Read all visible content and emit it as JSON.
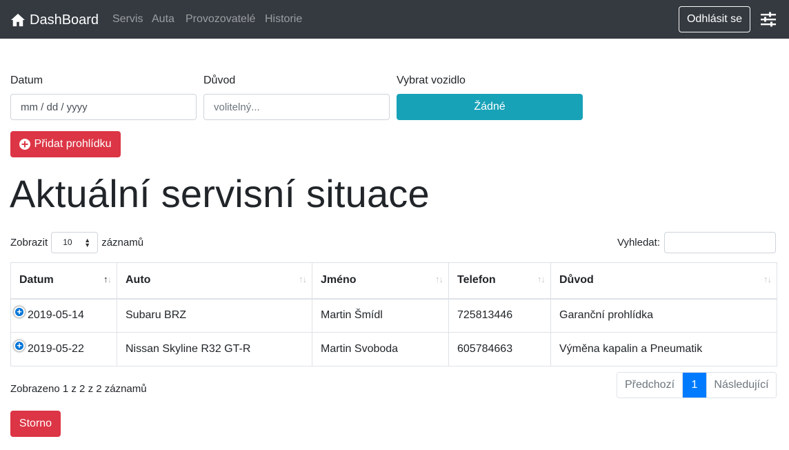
{
  "navbar": {
    "brand": "DashBoard",
    "links": [
      "Servis",
      "Auta",
      "Provozovatelé",
      "Historie"
    ],
    "logout_label": "Odhlásit se"
  },
  "form": {
    "date_label": "Datum",
    "date_placeholder": "mm / dd / yyyy",
    "reason_label": "Důvod",
    "reason_placeholder": "volitelný...",
    "vehicle_label": "Vybrat vozidlo",
    "vehicle_value": "Žádné",
    "add_button": "Přidat prohlídku"
  },
  "page_title": "Aktuální servisní situace",
  "datatable": {
    "length_prefix": "Zobrazit",
    "length_value": "10",
    "length_suffix": "záznamů",
    "search_label": "Vyhledat:",
    "columns": [
      "Datum",
      "Auto",
      "Jméno",
      "Telefon",
      "Důvod"
    ],
    "rows": [
      [
        "2019-05-14",
        "Subaru BRZ",
        "Martin Šmídl",
        "725813446",
        "Garanční prohlídka"
      ],
      [
        "2019-05-22",
        "Nissan Skyline R32 GT-R",
        "Martin Svoboda",
        "605784663",
        "Výměna kapalin a Pneumatik"
      ]
    ],
    "info": "Zobrazeno 1 z 2 z 2 záznamů",
    "pagination": {
      "prev": "Předchozí",
      "current": "1",
      "next": "Následující"
    }
  },
  "cancel_button": "Storno",
  "colors": {
    "navbar": "#343a40",
    "info": "#17a2b8",
    "danger": "#dc3545",
    "primary": "#007bff"
  }
}
